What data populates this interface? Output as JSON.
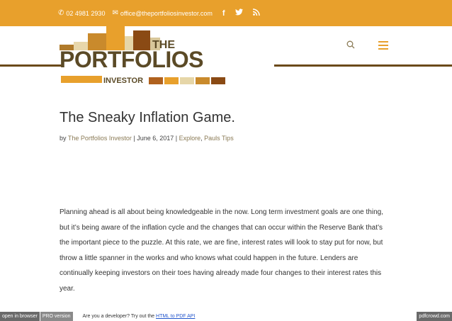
{
  "topbar": {
    "phone": "02 4981 2930",
    "email": "office@theportfoliosinvestor.com",
    "social": [
      "f",
      "t",
      "rss"
    ]
  },
  "logo": {
    "the": "THE",
    "portfolios": "PORTFOLIOS",
    "investor": "INVESTOR"
  },
  "post": {
    "title": "The Sneaky Inflation Game.",
    "by": "by",
    "author": "The Portfolios Investor",
    "sep1": " | ",
    "date": "June 6, 2017",
    "sep2": " | ",
    "cat1": "Explore",
    "comma": ", ",
    "cat2": "Pauls Tips",
    "body": "Planning ahead is all about being knowledgeable in the now. Long term investment goals are one thing, but it’s being aware of the inflation cycle and the changes that can occur within the Reserve Bank that’s the important piece to the puzzle. At this rate, we are fine, interest rates will look to stay put for now, but throw a little spanner in the works and who knows what could happen in the future. Lenders are continually keeping investors on their toes having already made four changes to their interest rates this year."
  },
  "pdfcrowd": {
    "open": "open in browser",
    "pro": "PRO version",
    "note": "Are you a developer? Try out the ",
    "link": "HTML to PDF API",
    "brand": "pdfcrowd.com"
  },
  "colors": {
    "accent": "#e8a02c",
    "brown": "#5b4a26"
  }
}
